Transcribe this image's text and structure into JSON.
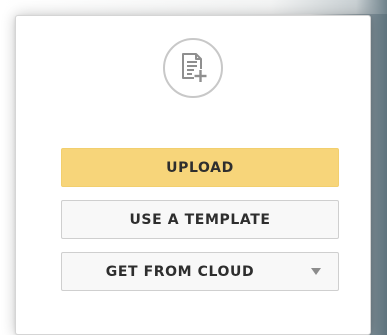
{
  "panel": {
    "icon": "add-document-icon",
    "buttons": {
      "upload": "UPLOAD",
      "template": "USE A TEMPLATE",
      "cloud": "GET FROM CLOUD"
    },
    "cloud_caret_icon": "caret-down-icon"
  },
  "colors": {
    "upload_bg": "#f7d57a",
    "secondary_bg": "#f8f8f8",
    "border": "#cfcfcf",
    "text": "#2e2e2e",
    "icon": "#8f8f8f"
  }
}
